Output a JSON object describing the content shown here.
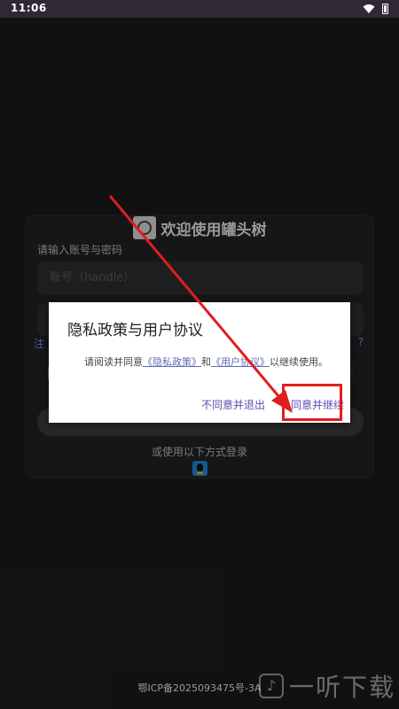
{
  "status_bar": {
    "time": "11:06",
    "wifi_icon": "wifi-icon",
    "battery_icon": "battery-icon"
  },
  "login": {
    "title": "欢迎使用罐头树",
    "label": "请输入账号与密码",
    "account_placeholder": "账号（handle）",
    "alt_login_text": "或使用以下方式登录",
    "alt_login_icon": "qq-icon"
  },
  "side_text": {
    "left": "注",
    "right": "?"
  },
  "dialog": {
    "title": "隐私政策与用户协议",
    "body_prefix": "请阅读并同意",
    "privacy_link": "《隐私政策》",
    "and": "和",
    "terms_link": "《用户协议》",
    "body_suffix": "以继续使用。",
    "disagree_button": "不同意并退出",
    "agree_button": "同意并继续"
  },
  "footer": {
    "icp": "鄂ICP备2025093475号-3A"
  },
  "watermark": {
    "text": "一听下载"
  },
  "colors": {
    "highlight": "#e21d1d",
    "link": "#5e6bb5",
    "button_text": "#5e4bb0"
  }
}
